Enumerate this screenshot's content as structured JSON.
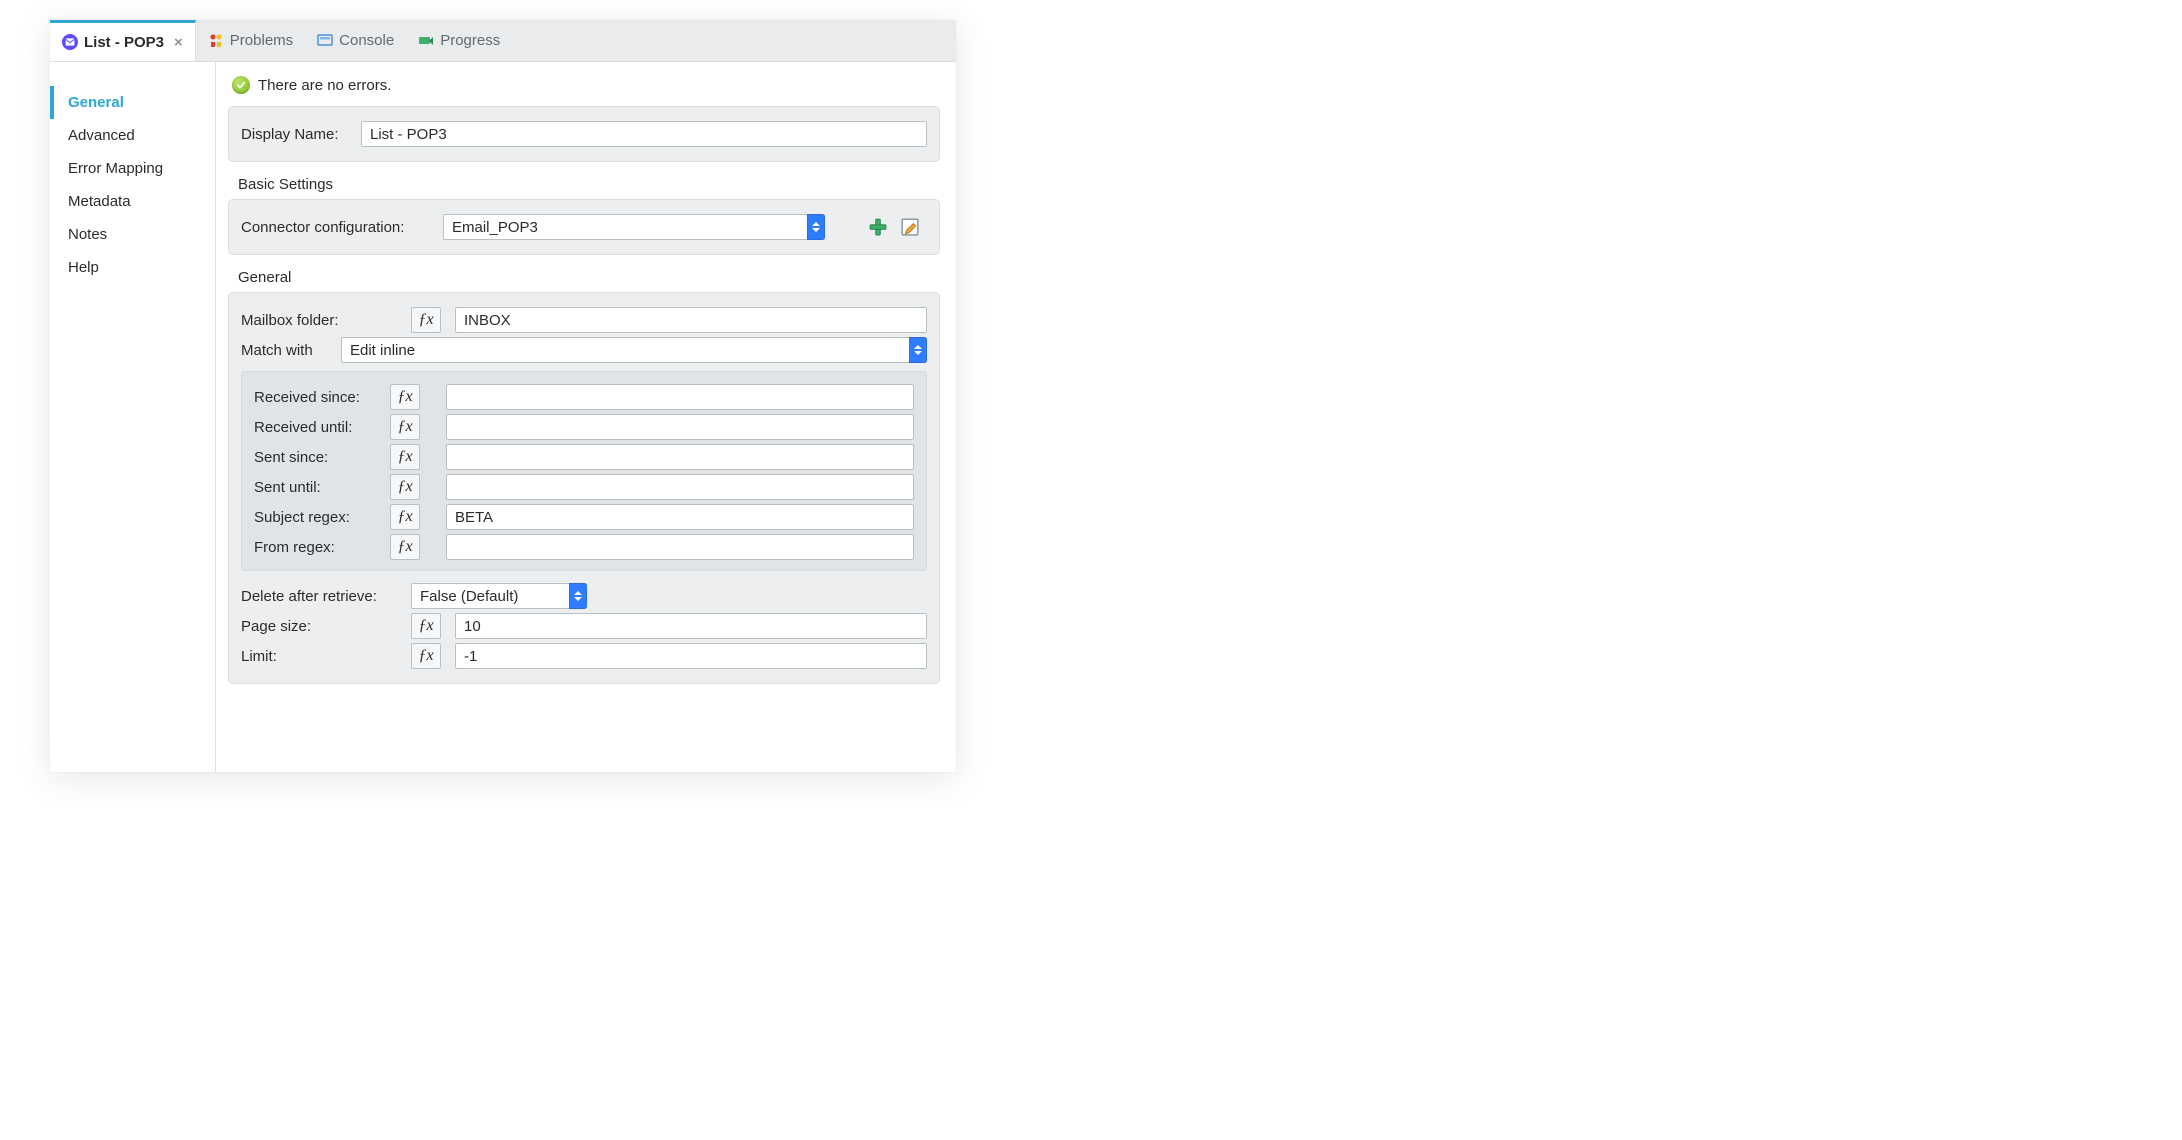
{
  "tabs": {
    "active": {
      "label": "List - POP3"
    },
    "others": [
      {
        "label": "Problems"
      },
      {
        "label": "Console"
      },
      {
        "label": "Progress"
      }
    ]
  },
  "sidebar": {
    "items": [
      {
        "label": "General",
        "active": true
      },
      {
        "label": "Advanced",
        "active": false
      },
      {
        "label": "Error Mapping",
        "active": false
      },
      {
        "label": "Metadata",
        "active": false
      },
      {
        "label": "Notes",
        "active": false
      },
      {
        "label": "Help",
        "active": false
      }
    ]
  },
  "status": {
    "message": "There are no errors."
  },
  "displayName": {
    "label": "Display Name:",
    "value": "List - POP3"
  },
  "basicSettings": {
    "title": "Basic Settings",
    "connectorLabel": "Connector configuration:",
    "connectorValue": "Email_POP3"
  },
  "general": {
    "title": "General",
    "mailboxFolder": {
      "label": "Mailbox folder:",
      "value": "INBOX"
    },
    "matchWith": {
      "label": "Match with",
      "value": "Edit inline"
    },
    "match": {
      "receivedSince": {
        "label": "Received since:",
        "value": ""
      },
      "receivedUntil": {
        "label": "Received until:",
        "value": ""
      },
      "sentSince": {
        "label": "Sent since:",
        "value": ""
      },
      "sentUntil": {
        "label": "Sent until:",
        "value": ""
      },
      "subjectRegex": {
        "label": "Subject regex:",
        "value": "BETA"
      },
      "fromRegex": {
        "label": "From regex:",
        "value": ""
      }
    },
    "deleteAfterRetrieve": {
      "label": "Delete after retrieve:",
      "value": "False (Default)"
    },
    "pageSize": {
      "label": "Page size:",
      "value": "10"
    },
    "limit": {
      "label": "Limit:",
      "value": "-1"
    }
  }
}
